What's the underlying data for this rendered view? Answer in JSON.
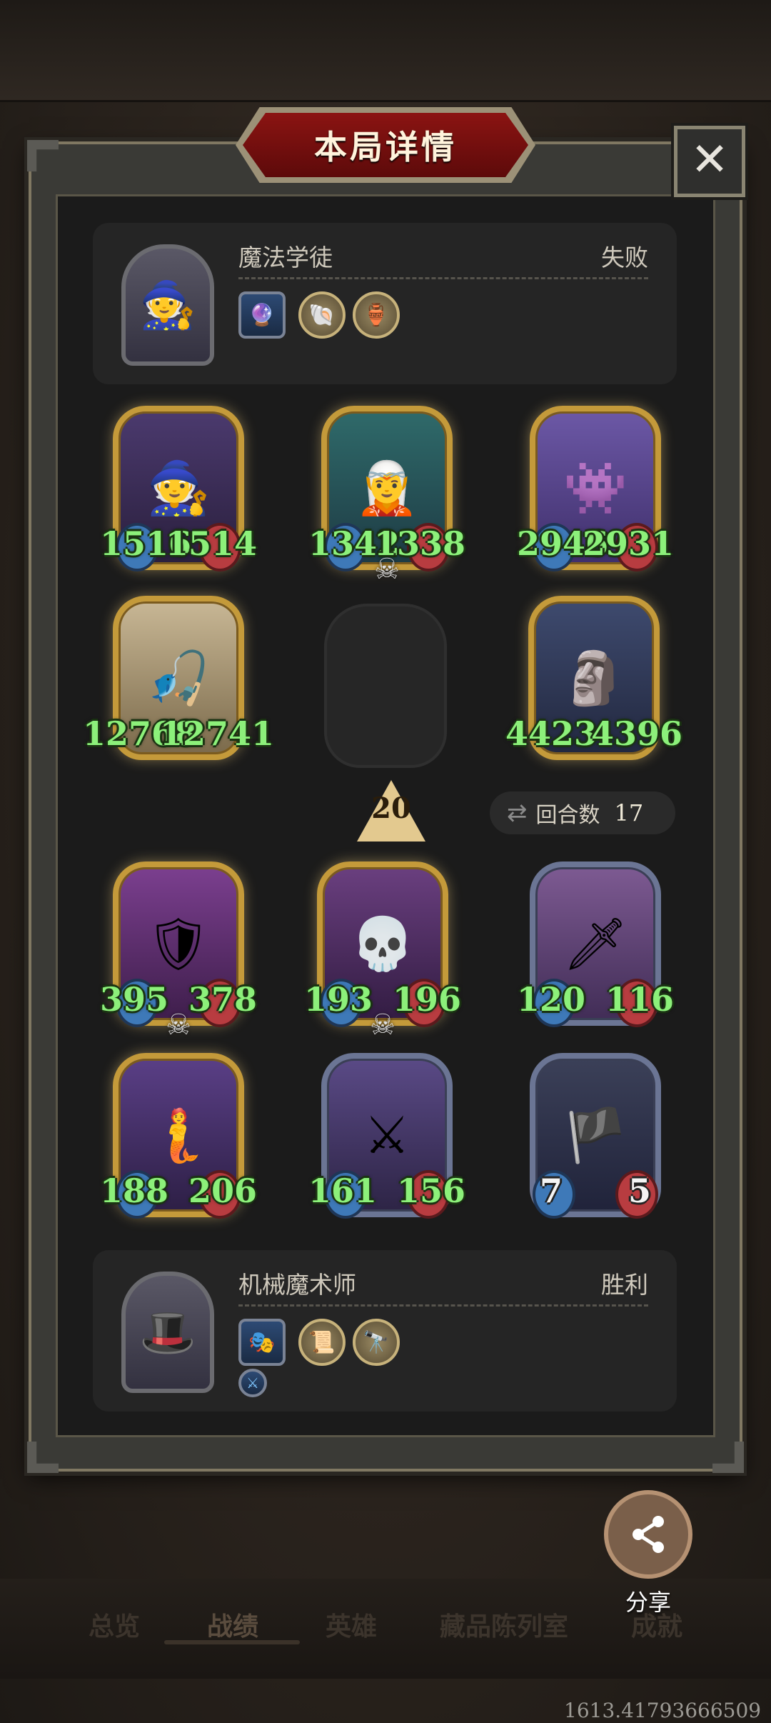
{
  "dialog": {
    "title": "本局详情",
    "close_label": "✕"
  },
  "opponent": {
    "name": "魔法学徒",
    "result": "失败",
    "portrait_icon": "🧙",
    "equipment": [
      "🔮",
      "🐚",
      "🏺"
    ]
  },
  "player": {
    "name": "机械魔术师",
    "result": "胜利",
    "portrait_icon": "🎩",
    "equipment": [
      "🎭",
      "📜",
      "🔭"
    ],
    "extra_badge": "⚔"
  },
  "opponent_board": [
    {
      "atk": "1516",
      "hp": "1514",
      "icon": "🧙",
      "dead": false
    },
    {
      "atk": "1342",
      "hp": "1338",
      "icon": "🧝",
      "dead": true
    },
    {
      "atk": "2946",
      "hp": "2931",
      "icon": "👾",
      "dead": false
    },
    {
      "atk": "12768",
      "hp": "12741",
      "icon": "🎣",
      "dead": false
    },
    {
      "atk": "4423",
      "hp": "4396",
      "icon": "🗿",
      "dead": false
    }
  ],
  "tier": "20",
  "round": {
    "label": "回合数",
    "value": "17"
  },
  "player_board": [
    {
      "atk": "395",
      "hp": "378",
      "icon": "🛡",
      "dead": true
    },
    {
      "atk": "193",
      "hp": "196",
      "icon": "💀",
      "dead": true
    },
    {
      "atk": "120",
      "hp": "116",
      "icon": "🗡",
      "dead": false
    },
    {
      "atk": "188",
      "hp": "206",
      "icon": "🧜",
      "dead": false
    },
    {
      "atk": "161",
      "hp": "156",
      "icon": "⚔",
      "dead": false
    },
    {
      "atk": "7",
      "hp": "5",
      "icon": "🏴",
      "dead": false
    }
  ],
  "share": {
    "label": "分享",
    "icon": "⟨"
  },
  "tabs": [
    "总览",
    "战绩",
    "英雄",
    "藏品陈列室",
    "成就"
  ],
  "coords": "1613.41793666509"
}
